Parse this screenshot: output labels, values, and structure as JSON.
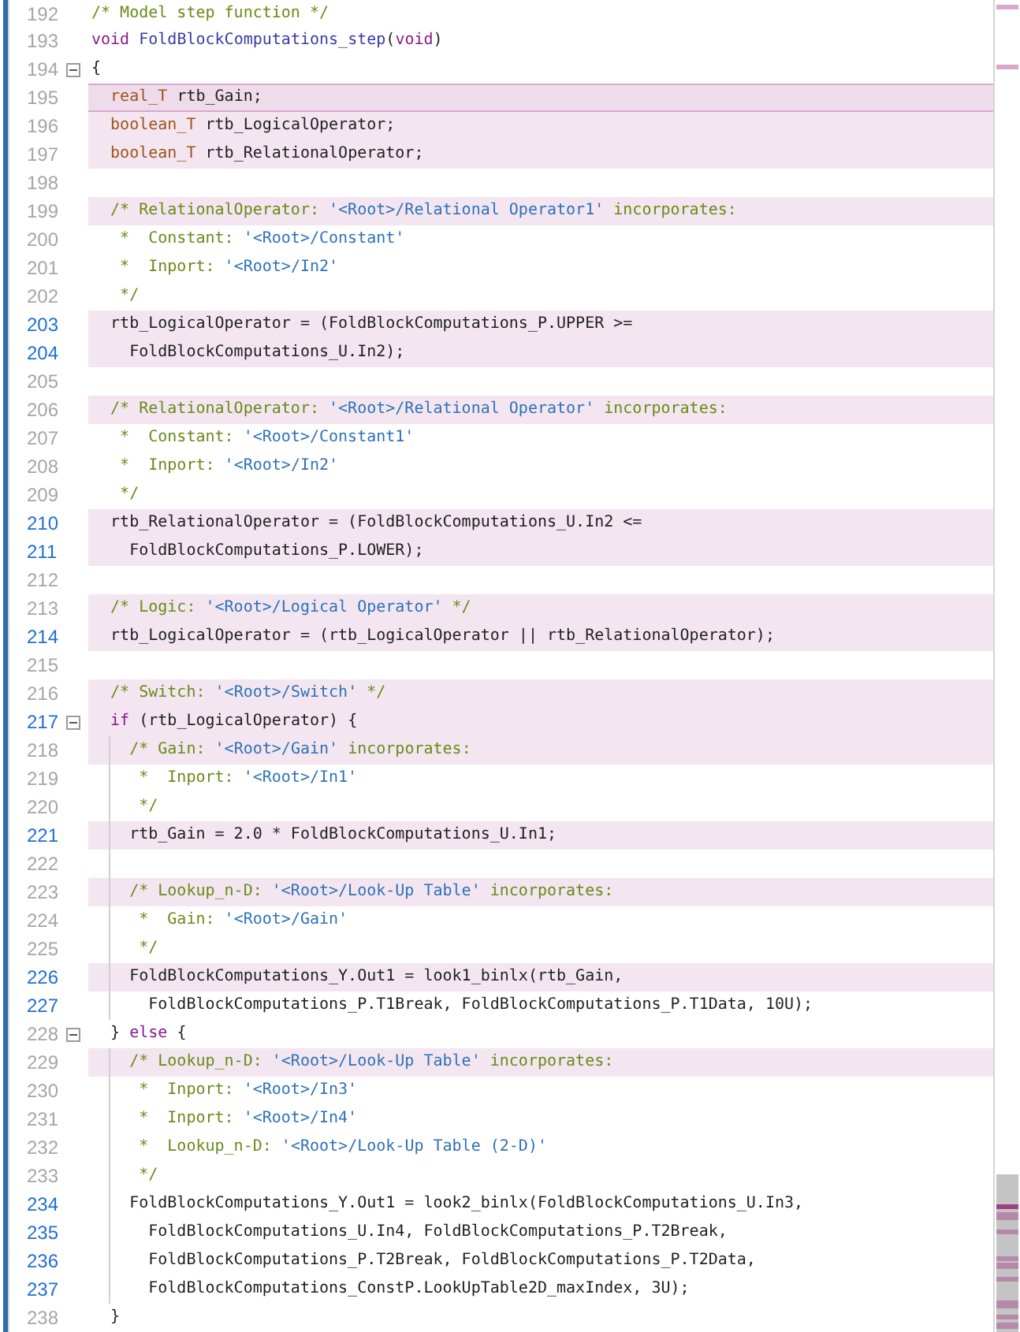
{
  "lines": [
    {
      "n": "192",
      "seg": [
        {
          "kind": "cm",
          "t": "/* Model step function */"
        }
      ],
      "hl": false,
      "sel": false,
      "linked": false,
      "fold": false,
      "guide": false
    },
    {
      "n": "193",
      "seg": [
        {
          "kind": "kw",
          "t": "void"
        },
        {
          "kind": "fn",
          "t": " FoldBlockComputations_step"
        },
        {
          "kind": "pl",
          "t": "("
        },
        {
          "kind": "kw",
          "t": "void"
        },
        {
          "kind": "pl",
          "t": ")"
        }
      ],
      "hl": false,
      "sel": false,
      "linked": false,
      "fold": false,
      "guide": false
    },
    {
      "n": "194",
      "seg": [
        {
          "kind": "pl",
          "t": "{"
        }
      ],
      "hl": false,
      "sel": false,
      "linked": false,
      "fold": true,
      "guide": false
    },
    {
      "n": "195",
      "seg": [
        {
          "kind": "type",
          "t": "  real_T"
        },
        {
          "kind": "pl",
          "t": " rtb_Gain;"
        }
      ],
      "hl": true,
      "sel": true,
      "linked": false,
      "fold": false,
      "guide": false
    },
    {
      "n": "196",
      "seg": [
        {
          "kind": "type",
          "t": "  boolean_T"
        },
        {
          "kind": "pl",
          "t": " rtb_LogicalOperator;"
        }
      ],
      "hl": true,
      "sel": false,
      "linked": false,
      "fold": false,
      "guide": false
    },
    {
      "n": "197",
      "seg": [
        {
          "kind": "type",
          "t": "  boolean_T"
        },
        {
          "kind": "pl",
          "t": " rtb_RelationalOperator;"
        }
      ],
      "hl": true,
      "sel": false,
      "linked": false,
      "fold": false,
      "guide": false
    },
    {
      "n": "198",
      "hl": false,
      "sel": false,
      "linked": false,
      "fold": false,
      "guide": false
    },
    {
      "n": "199",
      "seg": [
        {
          "kind": "cm",
          "t": "  /* RelationalOperator: "
        },
        {
          "kind": "str",
          "t": "'<Root>/Relational Operator1'"
        },
        {
          "kind": "cm",
          "t": " incorporates:"
        }
      ],
      "hl": true,
      "sel": false,
      "linked": false,
      "fold": false,
      "guide": false
    },
    {
      "n": "200",
      "seg": [
        {
          "kind": "cm",
          "t": "   *  Constant: "
        },
        {
          "kind": "str",
          "t": "'<Root>/Constant'"
        }
      ],
      "hl": false,
      "sel": false,
      "linked": false,
      "fold": false,
      "guide": false
    },
    {
      "n": "201",
      "seg": [
        {
          "kind": "cm",
          "t": "   *  Inport: "
        },
        {
          "kind": "str",
          "t": "'<Root>/In2'"
        }
      ],
      "hl": false,
      "sel": false,
      "linked": false,
      "fold": false,
      "guide": false
    },
    {
      "n": "202",
      "seg": [
        {
          "kind": "cm",
          "t": "   */"
        }
      ],
      "hl": false,
      "sel": false,
      "linked": false,
      "fold": false,
      "guide": false
    },
    {
      "n": "203",
      "seg": [
        {
          "kind": "pl",
          "t": "  rtb_LogicalOperator = (FoldBlockComputations_P.UPPER >="
        }
      ],
      "hl": true,
      "sel": false,
      "linked": true,
      "fold": false,
      "guide": false
    },
    {
      "n": "204",
      "seg": [
        {
          "kind": "pl",
          "t": "    FoldBlockComputations_U.In2);"
        }
      ],
      "hl": true,
      "sel": false,
      "linked": true,
      "fold": false,
      "guide": false
    },
    {
      "n": "205",
      "hl": false,
      "sel": false,
      "linked": false,
      "fold": false,
      "guide": false
    },
    {
      "n": "206",
      "seg": [
        {
          "kind": "cm",
          "t": "  /* RelationalOperator: "
        },
        {
          "kind": "str",
          "t": "'<Root>/Relational Operator'"
        },
        {
          "kind": "cm",
          "t": " incorporates:"
        }
      ],
      "hl": true,
      "sel": false,
      "linked": false,
      "fold": false,
      "guide": false
    },
    {
      "n": "207",
      "seg": [
        {
          "kind": "cm",
          "t": "   *  Constant: "
        },
        {
          "kind": "str",
          "t": "'<Root>/Constant1'"
        }
      ],
      "hl": false,
      "sel": false,
      "linked": false,
      "fold": false,
      "guide": false
    },
    {
      "n": "208",
      "seg": [
        {
          "kind": "cm",
          "t": "   *  Inport: "
        },
        {
          "kind": "str",
          "t": "'<Root>/In2'"
        }
      ],
      "hl": false,
      "sel": false,
      "linked": false,
      "fold": false,
      "guide": false
    },
    {
      "n": "209",
      "seg": [
        {
          "kind": "cm",
          "t": "   */"
        }
      ],
      "hl": false,
      "sel": false,
      "linked": false,
      "fold": false,
      "guide": false
    },
    {
      "n": "210",
      "seg": [
        {
          "kind": "pl",
          "t": "  rtb_RelationalOperator = (FoldBlockComputations_U.In2 <="
        }
      ],
      "hl": true,
      "sel": false,
      "linked": true,
      "fold": false,
      "guide": false
    },
    {
      "n": "211",
      "seg": [
        {
          "kind": "pl",
          "t": "    FoldBlockComputations_P.LOWER);"
        }
      ],
      "hl": true,
      "sel": false,
      "linked": true,
      "fold": false,
      "guide": false
    },
    {
      "n": "212",
      "hl": false,
      "sel": false,
      "linked": false,
      "fold": false,
      "guide": false
    },
    {
      "n": "213",
      "seg": [
        {
          "kind": "cm",
          "t": "  /* Logic: "
        },
        {
          "kind": "str",
          "t": "'<Root>/Logical Operator'"
        },
        {
          "kind": "cm",
          "t": " */"
        }
      ],
      "hl": true,
      "sel": false,
      "linked": false,
      "fold": false,
      "guide": false
    },
    {
      "n": "214",
      "seg": [
        {
          "kind": "pl",
          "t": "  rtb_LogicalOperator = (rtb_LogicalOperator || rtb_RelationalOperator);"
        }
      ],
      "hl": true,
      "sel": false,
      "linked": true,
      "fold": false,
      "guide": false
    },
    {
      "n": "215",
      "hl": false,
      "sel": false,
      "linked": false,
      "fold": false,
      "guide": false
    },
    {
      "n": "216",
      "seg": [
        {
          "kind": "cm",
          "t": "  /* Switch: "
        },
        {
          "kind": "str",
          "t": "'<Root>/Switch'"
        },
        {
          "kind": "cm",
          "t": " */"
        }
      ],
      "hl": true,
      "sel": false,
      "linked": false,
      "fold": false,
      "guide": false
    },
    {
      "n": "217",
      "seg": [
        {
          "kind": "kw",
          "t": "  if"
        },
        {
          "kind": "pl",
          "t": " (rtb_LogicalOperator) {"
        }
      ],
      "hl": true,
      "sel": false,
      "linked": true,
      "fold": true,
      "guide": false
    },
    {
      "n": "218",
      "seg": [
        {
          "kind": "cm",
          "t": "    /* Gain: "
        },
        {
          "kind": "str",
          "t": "'<Root>/Gain'"
        },
        {
          "kind": "cm",
          "t": " incorporates:"
        }
      ],
      "hl": true,
      "sel": false,
      "linked": false,
      "fold": false,
      "guide": true
    },
    {
      "n": "219",
      "seg": [
        {
          "kind": "cm",
          "t": "     *  Inport: "
        },
        {
          "kind": "str",
          "t": "'<Root>/In1'"
        }
      ],
      "hl": false,
      "sel": false,
      "linked": false,
      "fold": false,
      "guide": true
    },
    {
      "n": "220",
      "seg": [
        {
          "kind": "cm",
          "t": "     */"
        }
      ],
      "hl": false,
      "sel": false,
      "linked": false,
      "fold": false,
      "guide": true
    },
    {
      "n": "221",
      "seg": [
        {
          "kind": "pl",
          "t": "    rtb_Gain = 2.0 * FoldBlockComputations_U.In1;"
        }
      ],
      "hl": true,
      "sel": false,
      "linked": true,
      "fold": false,
      "guide": true
    },
    {
      "n": "222",
      "hl": false,
      "sel": false,
      "linked": false,
      "fold": false,
      "guide": true
    },
    {
      "n": "223",
      "seg": [
        {
          "kind": "cm",
          "t": "    /* Lookup_n-D: "
        },
        {
          "kind": "str",
          "t": "'<Root>/Look-Up Table'"
        },
        {
          "kind": "cm",
          "t": " incorporates:"
        }
      ],
      "hl": true,
      "sel": false,
      "linked": false,
      "fold": false,
      "guide": true
    },
    {
      "n": "224",
      "seg": [
        {
          "kind": "cm",
          "t": "     *  Gain: "
        },
        {
          "kind": "str",
          "t": "'<Root>/Gain'"
        }
      ],
      "hl": false,
      "sel": false,
      "linked": false,
      "fold": false,
      "guide": true
    },
    {
      "n": "225",
      "seg": [
        {
          "kind": "cm",
          "t": "     */"
        }
      ],
      "hl": false,
      "sel": false,
      "linked": false,
      "fold": false,
      "guide": true
    },
    {
      "n": "226",
      "seg": [
        {
          "kind": "pl",
          "t": "    FoldBlockComputations_Y.Out1 = look1_binlx(rtb_Gain,"
        }
      ],
      "hl": true,
      "sel": false,
      "linked": true,
      "fold": false,
      "guide": true
    },
    {
      "n": "227",
      "seg": [
        {
          "kind": "pl",
          "t": "      FoldBlockComputations_P.T1Break, FoldBlockComputations_P.T1Data, 10U);"
        }
      ],
      "hl": false,
      "sel": false,
      "linked": true,
      "fold": false,
      "guide": true
    },
    {
      "n": "228",
      "seg": [
        {
          "kind": "pl",
          "t": "  } "
        },
        {
          "kind": "kw",
          "t": "else"
        },
        {
          "kind": "pl",
          "t": " {"
        }
      ],
      "hl": false,
      "sel": false,
      "linked": false,
      "fold": true,
      "guide": false
    },
    {
      "n": "229",
      "seg": [
        {
          "kind": "cm",
          "t": "    /* Lookup_n-D: "
        },
        {
          "kind": "str",
          "t": "'<Root>/Look-Up Table'"
        },
        {
          "kind": "cm",
          "t": " incorporates:"
        }
      ],
      "hl": true,
      "sel": false,
      "linked": false,
      "fold": false,
      "guide": true
    },
    {
      "n": "230",
      "seg": [
        {
          "kind": "cm",
          "t": "     *  Inport: "
        },
        {
          "kind": "str",
          "t": "'<Root>/In3'"
        }
      ],
      "hl": false,
      "sel": false,
      "linked": false,
      "fold": false,
      "guide": true
    },
    {
      "n": "231",
      "seg": [
        {
          "kind": "cm",
          "t": "     *  Inport: "
        },
        {
          "kind": "str",
          "t": "'<Root>/In4'"
        }
      ],
      "hl": false,
      "sel": false,
      "linked": false,
      "fold": false,
      "guide": true
    },
    {
      "n": "232",
      "seg": [
        {
          "kind": "cm",
          "t": "     *  Lookup_n-D: "
        },
        {
          "kind": "str",
          "t": "'<Root>/Look-Up Table (2-D)'"
        }
      ],
      "hl": false,
      "sel": false,
      "linked": false,
      "fold": false,
      "guide": true
    },
    {
      "n": "233",
      "seg": [
        {
          "kind": "cm",
          "t": "     */"
        }
      ],
      "hl": false,
      "sel": false,
      "linked": false,
      "fold": false,
      "guide": true
    },
    {
      "n": "234",
      "seg": [
        {
          "kind": "pl",
          "t": "    FoldBlockComputations_Y.Out1 = look2_binlx(FoldBlockComputations_U.In3,"
        }
      ],
      "hl": false,
      "sel": false,
      "linked": true,
      "fold": false,
      "guide": true
    },
    {
      "n": "235",
      "seg": [
        {
          "kind": "pl",
          "t": "      FoldBlockComputations_U.In4, FoldBlockComputations_P.T2Break,"
        }
      ],
      "hl": false,
      "sel": false,
      "linked": true,
      "fold": false,
      "guide": true
    },
    {
      "n": "236",
      "seg": [
        {
          "kind": "pl",
          "t": "      FoldBlockComputations_P.T2Break, FoldBlockComputations_P.T2Data,"
        }
      ],
      "hl": false,
      "sel": false,
      "linked": true,
      "fold": false,
      "guide": true
    },
    {
      "n": "237",
      "seg": [
        {
          "kind": "pl",
          "t": "      FoldBlockComputations_ConstP.LookUpTable2D_maxIndex, 3U);"
        }
      ],
      "hl": false,
      "sel": false,
      "linked": true,
      "fold": false,
      "guide": true
    },
    {
      "n": "238",
      "seg": [
        {
          "kind": "pl",
          "t": "  }"
        }
      ],
      "hl": false,
      "sel": false,
      "linked": false,
      "fold": false,
      "guide": false
    }
  ]
}
